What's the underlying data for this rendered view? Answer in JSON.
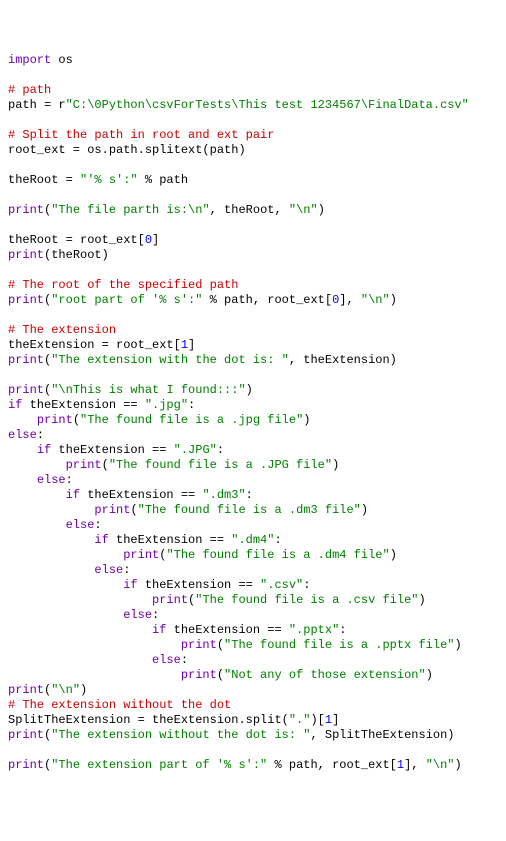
{
  "code": {
    "t": [
      "import",
      " os",
      "# path",
      "path = r",
      "\"C:\\0Python\\csvForTests\\This test 1234567\\FinalData.csv\"",
      "# Split the path in root and ext pair",
      "root_ext = os.path.splitext(path)",
      "theRoot = ",
      "\"'% s':\"",
      " % path",
      "print",
      "(",
      "\"The file parth is:\\n\"",
      ", theRoot, ",
      "\"\\n\"",
      ")",
      "theRoot = root_ext[",
      "0",
      "]",
      "print",
      "(theRoot)",
      "# The root of the specified path",
      "print",
      "(",
      "\"root part of '% s':\"",
      " % path, root_ext[",
      "0",
      "], ",
      "\"\\n\"",
      ")",
      "# The extension",
      "theExtension = root_ext[",
      "1",
      "]",
      "print",
      "(",
      "\"The extension with the dot is: \"",
      ", theExtension)",
      "print",
      "(",
      "\"\\nThis is what I found:::\"",
      ")",
      "if",
      " theExtension == ",
      "\".jpg\"",
      ":",
      "    ",
      "print",
      "(",
      "\"The found file is a .jpg file\"",
      ")",
      "else",
      ":",
      "    ",
      "if",
      " theExtension == ",
      "\".JPG\"",
      ":",
      "        ",
      "print",
      "(",
      "\"The found file is a .JPG file\"",
      ")",
      "    ",
      "else",
      ":",
      "        ",
      "if",
      " theExtension == ",
      "\".dm3\"",
      ":",
      "            ",
      "print",
      "(",
      "\"The found file is a .dm3 file\"",
      ")",
      "        ",
      "else",
      ":",
      "            ",
      "if",
      " theExtension == ",
      "\".dm4\"",
      ":",
      "                ",
      "print",
      "(",
      "\"The found file is a .dm4 file\"",
      ")",
      "            ",
      "else",
      ":",
      "                ",
      "if",
      " theExtension == ",
      "\".csv\"",
      ":",
      "                    ",
      "print",
      "(",
      "\"The found file is a .csv file\"",
      ")",
      "                ",
      "else",
      ":",
      "                    ",
      "if",
      " theExtension == ",
      "\".pptx\"",
      ":",
      "                        ",
      "print",
      "(",
      "\"The found file is a .pptx file\"",
      ")",
      "                    ",
      "else",
      ":",
      "                        ",
      "print",
      "(",
      "\"Not any of those extension\"",
      ")",
      "print",
      "(",
      "\"\\n\"",
      ")",
      "# The extension without the dot",
      "SplitTheExtension = theExtension.split(",
      "\".\"",
      ")[",
      "1",
      "]",
      "print",
      "(",
      "\"The extension without the dot is: \"",
      ", SplitTheExtension)",
      "print",
      "(",
      "\"The extension part of '% s':\"",
      " % path, root_ext[",
      "1",
      "], ",
      "\"\\n\"",
      ")"
    ]
  }
}
